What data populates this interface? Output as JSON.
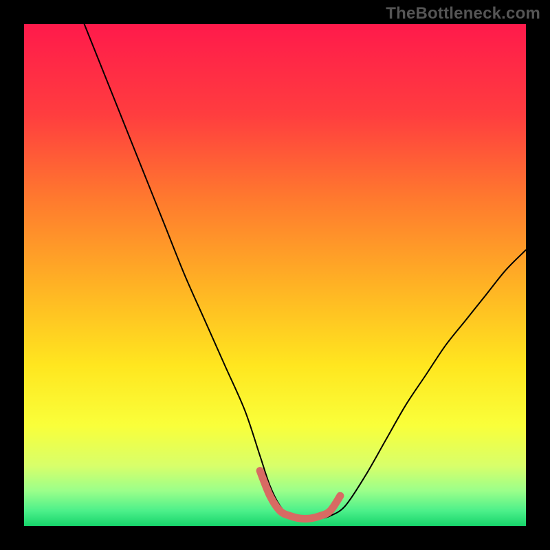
{
  "watermark": "TheBottleneck.com",
  "chart_data": {
    "type": "line",
    "title": "",
    "xlabel": "",
    "ylabel": "",
    "xlim": [
      0,
      100
    ],
    "ylim": [
      0,
      100
    ],
    "grid": false,
    "legend": false,
    "series": [
      {
        "name": "curve",
        "x": [
          12,
          16,
          20,
          24,
          28,
          32,
          36,
          40,
          44,
          47,
          49,
          51,
          53,
          55,
          57,
          59,
          61,
          64,
          68,
          72,
          76,
          80,
          84,
          88,
          92,
          96,
          100
        ],
        "y": [
          100,
          90,
          80,
          70,
          60,
          50,
          41,
          32,
          23,
          14,
          8,
          4,
          2,
          1.5,
          1.5,
          1.5,
          2,
          4,
          10,
          17,
          24,
          30,
          36,
          41,
          46,
          51,
          55
        ]
      }
    ],
    "accent": {
      "name": "trough-highlight",
      "color": "#d86a63",
      "x": [
        47,
        49,
        51,
        53,
        55,
        57,
        59,
        61,
        63
      ],
      "y": [
        11,
        6,
        3,
        2,
        1.5,
        1.5,
        2,
        3,
        6
      ]
    },
    "background_gradient_stops": [
      {
        "offset": 0.0,
        "color": "#ff1a4b"
      },
      {
        "offset": 0.18,
        "color": "#ff3d3f"
      },
      {
        "offset": 0.35,
        "color": "#ff7a2e"
      },
      {
        "offset": 0.52,
        "color": "#ffb224"
      },
      {
        "offset": 0.68,
        "color": "#ffe61f"
      },
      {
        "offset": 0.8,
        "color": "#f9ff3a"
      },
      {
        "offset": 0.88,
        "color": "#d8ff6a"
      },
      {
        "offset": 0.93,
        "color": "#9bff8a"
      },
      {
        "offset": 0.97,
        "color": "#4cf08a"
      },
      {
        "offset": 1.0,
        "color": "#17d46b"
      }
    ]
  }
}
